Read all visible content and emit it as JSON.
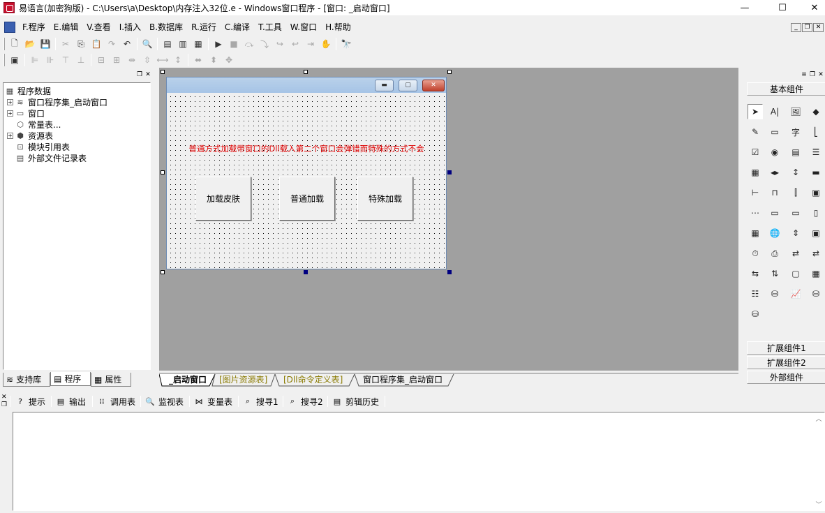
{
  "window": {
    "title": "易语言(加密狗版) - C:\\Users\\a\\Desktop\\内存注入32位.e - Windows窗口程序 - [窗口: _启动窗口]",
    "minimize": "—",
    "maximize": "☐",
    "close": "✕"
  },
  "menu": {
    "items": [
      "F.程序",
      "E.编辑",
      "V.查看",
      "I.插入",
      "B.数据库",
      "R.运行",
      "C.编译",
      "T.工具",
      "W.窗口",
      "H.帮助"
    ]
  },
  "tree": {
    "root": "程序数据",
    "items": [
      {
        "label": "窗口程序集_启动窗口",
        "expander": "+"
      },
      {
        "label": "窗口",
        "expander": "+"
      },
      {
        "label": "常量表...",
        "expander": ""
      },
      {
        "label": "资源表",
        "expander": "+"
      },
      {
        "label": "模块引用表",
        "expander": ""
      },
      {
        "label": "外部文件记录表",
        "expander": ""
      }
    ]
  },
  "left_tabs": {
    "support": "支持库",
    "program": "程序",
    "property": "属性"
  },
  "form": {
    "label": "普通方式加载带窗口的Dll载入第二个窗口会弹错而特殊的方式不会",
    "btn_skin": "加载皮肤",
    "btn_normal": "普通加载",
    "btn_special": "特殊加载"
  },
  "designer_tabs": {
    "start": "_启动窗口",
    "images": "[图片资源表]",
    "dll": "[Dll命令定义表]",
    "assembly": "窗口程序集_启动窗口"
  },
  "toolbox": {
    "basic": "基本组件",
    "ext1": "扩展组件1",
    "ext2": "扩展组件2",
    "external": "外部组件"
  },
  "output_tabs": {
    "tip": "提示",
    "output": "输出",
    "calls": "调用表",
    "watch": "监视表",
    "vars": "变量表",
    "find1": "搜寻1",
    "find2": "搜寻2",
    "clip": "剪辑历史"
  },
  "colors": {
    "label_red": "#e00000",
    "designer_bg": "#a0a0a0",
    "form_caption": "#b9d1ea"
  }
}
